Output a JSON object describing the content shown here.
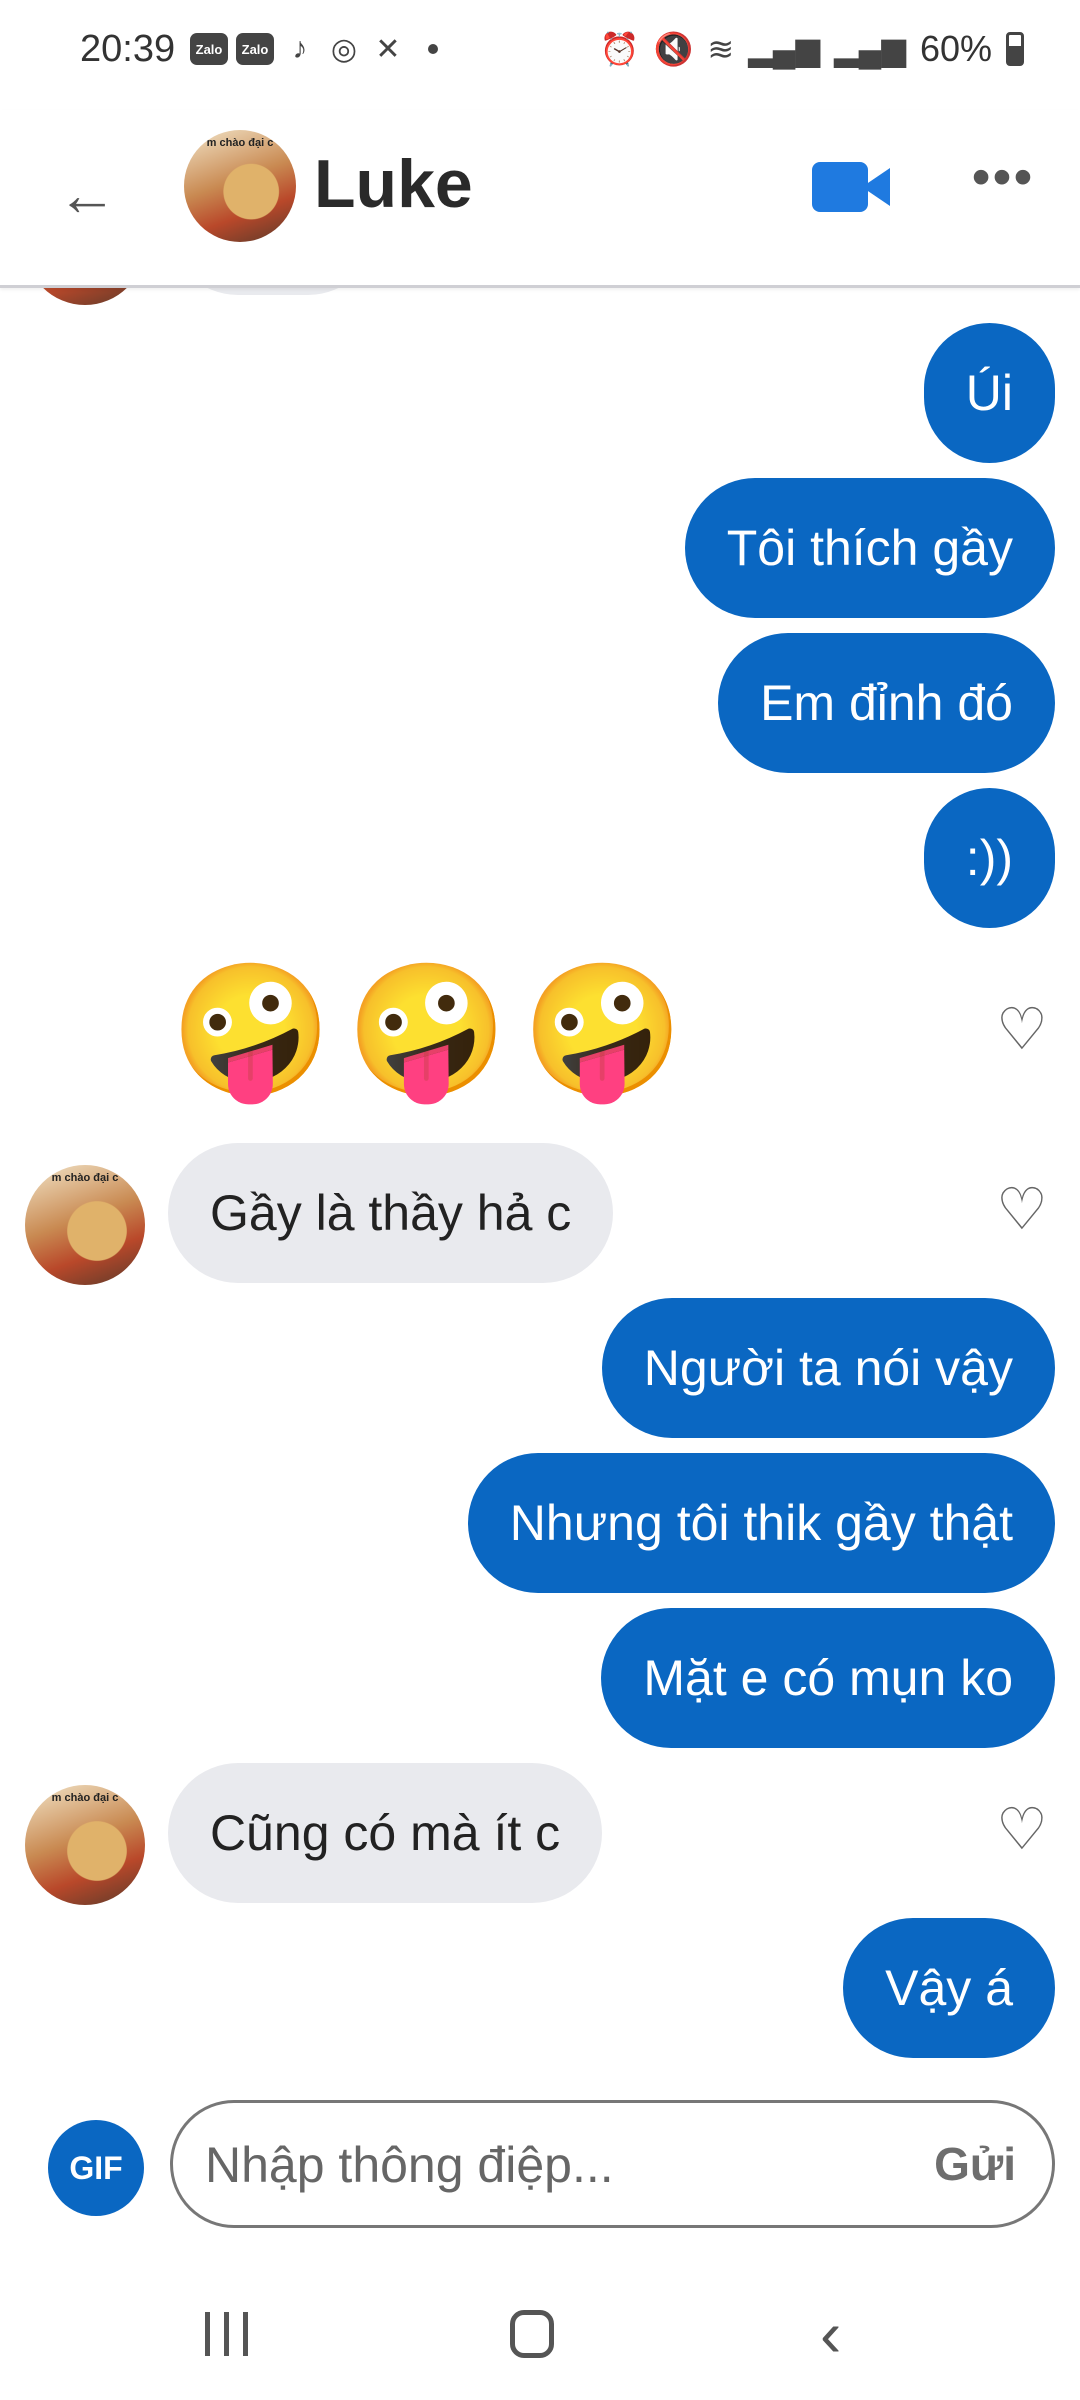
{
  "status_bar": {
    "time": "20:39",
    "apps": [
      "Zalo",
      "Zalo"
    ],
    "battery": "60%",
    "icons": [
      "alarm-icon",
      "mute-icon",
      "wifi-icon",
      "signal-icon",
      "signal-icon",
      "battery-icon"
    ]
  },
  "header": {
    "contact_name": "Luke",
    "avatar_caption": "m chào đại c"
  },
  "messages": [
    {
      "direction": "out",
      "text": "Úi"
    },
    {
      "direction": "out",
      "text": "Tôi thích gầy"
    },
    {
      "direction": "out",
      "text": "Em đỉnh đó"
    },
    {
      "direction": "out",
      "text": ":))"
    },
    {
      "direction": "in",
      "type": "emoji",
      "text": "🤪🤪🤪"
    },
    {
      "direction": "in",
      "text": "Gầy là thầy hả c"
    },
    {
      "direction": "out",
      "text": "Người ta nói vậy"
    },
    {
      "direction": "out",
      "text": "Nhưng tôi thik gầy thật"
    },
    {
      "direction": "out",
      "text": "Mặt e có mụn ko"
    },
    {
      "direction": "in",
      "text": "Cũng có mà ít c"
    },
    {
      "direction": "out",
      "text": "Vậy á"
    }
  ],
  "emoji": {
    "glyph": "🤪"
  },
  "composer": {
    "gif_label": "GIF",
    "placeholder": "Nhập thông điệp...",
    "send_label": "Gửi"
  },
  "colors": {
    "outgoing_bubble": "#0a67c2",
    "incoming_bubble": "#e9eaee",
    "accent": "#1f7ae0"
  }
}
